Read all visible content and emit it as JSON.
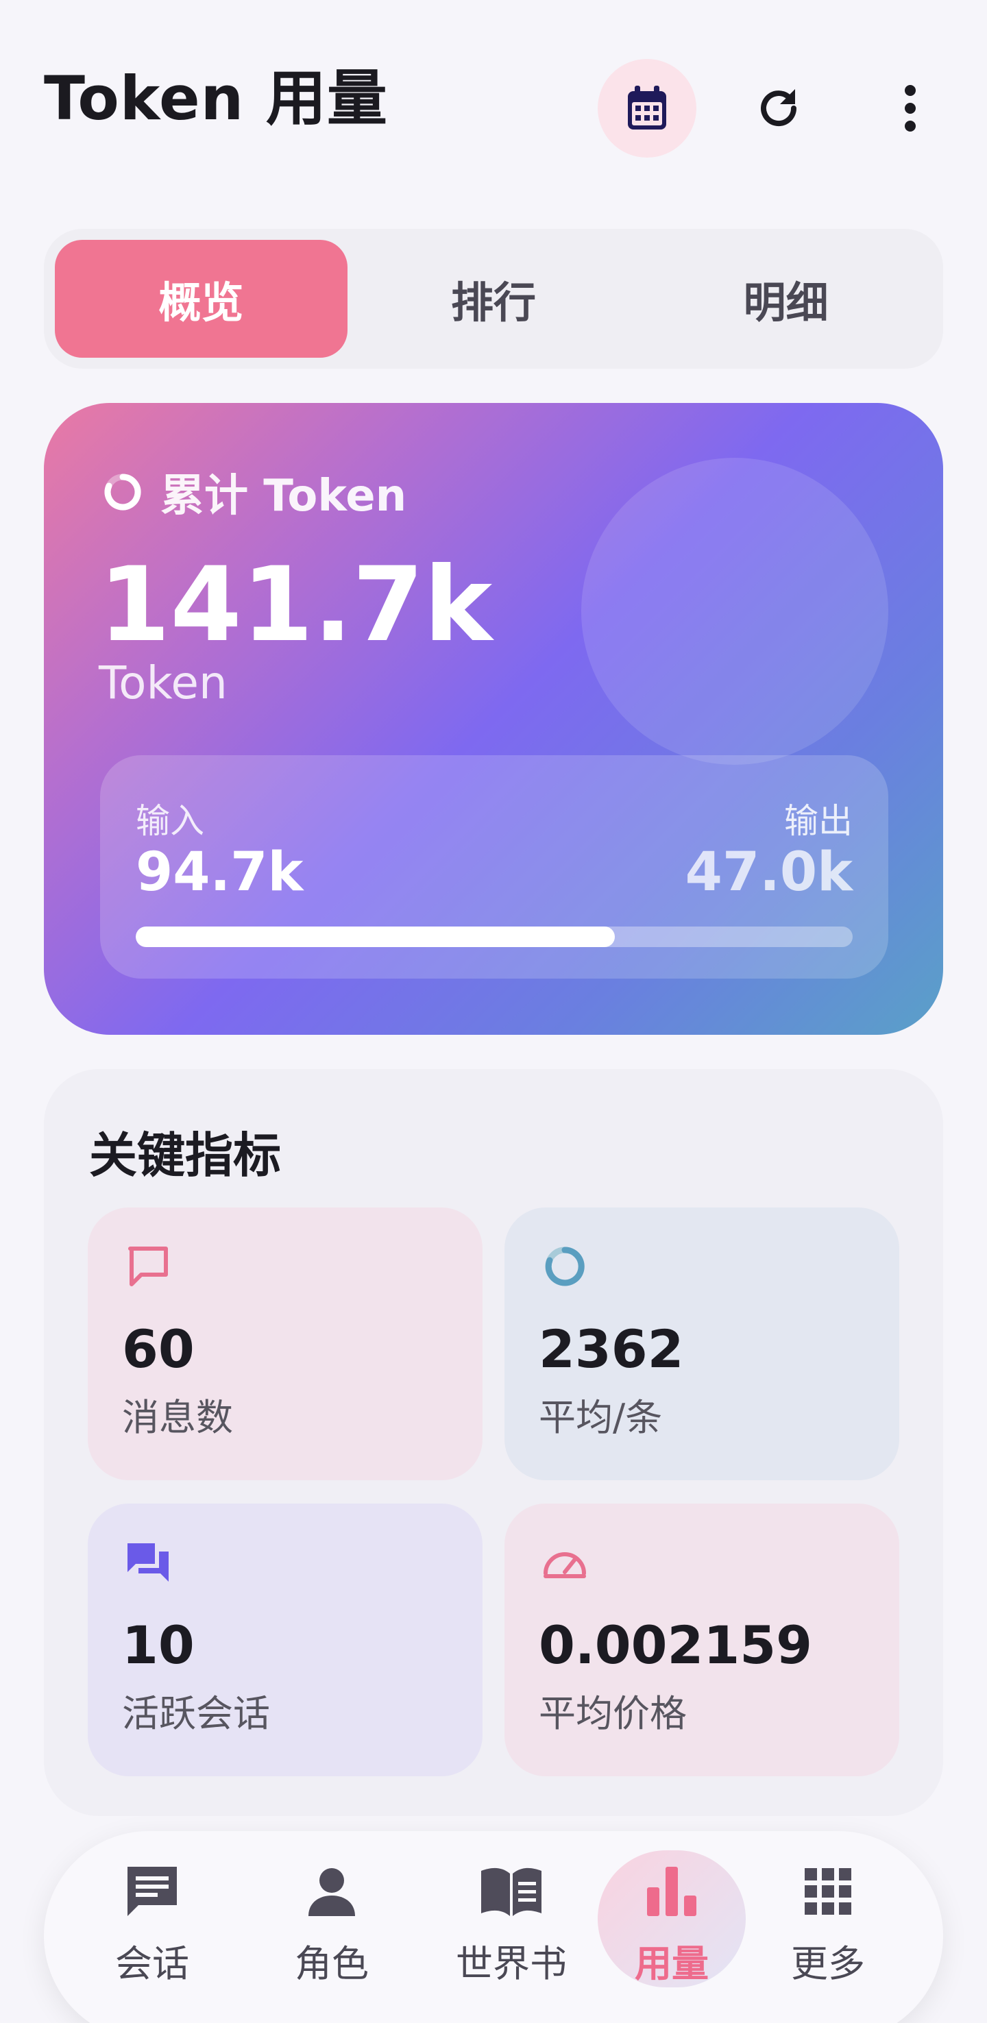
{
  "header": {
    "title": "Token 用量",
    "icons": [
      "calendar-icon",
      "refresh-icon",
      "more-vert-icon"
    ]
  },
  "tabs": [
    {
      "label": "概览",
      "active": true
    },
    {
      "label": "排行",
      "active": false
    },
    {
      "label": "明细",
      "active": false
    }
  ],
  "summary": {
    "label": "累计 Token",
    "total": "141.7k",
    "unit": "Token",
    "input_label": "输入",
    "input_value": "94.7k",
    "output_label": "输出",
    "output_value": "47.0k",
    "input_share": 0.668
  },
  "metrics": {
    "title": "关键指标",
    "items": [
      {
        "value": "60",
        "label": "消息数",
        "icon": "chat-bubble-icon"
      },
      {
        "value": "2362",
        "label": "平均/条",
        "icon": "ring-icon"
      },
      {
        "value": "10",
        "label": "活跃会话",
        "icon": "forum-icon"
      },
      {
        "value": "0.002159",
        "label": "平均价格",
        "icon": "speed-gauge-icon"
      }
    ]
  },
  "nav": [
    {
      "label": "会话",
      "icon": "chat-icon",
      "active": false
    },
    {
      "label": "角色",
      "icon": "person-icon",
      "active": false
    },
    {
      "label": "世界书",
      "icon": "book-icon",
      "active": false
    },
    {
      "label": "用量",
      "icon": "bar-chart-icon",
      "active": true
    },
    {
      "label": "更多",
      "icon": "grid-icon",
      "active": false
    }
  ],
  "colors": {
    "accent": "#f07592",
    "hero_start": "#e97aa4",
    "hero_mid": "#7e69f0",
    "hero_end": "#5aa0c8"
  }
}
